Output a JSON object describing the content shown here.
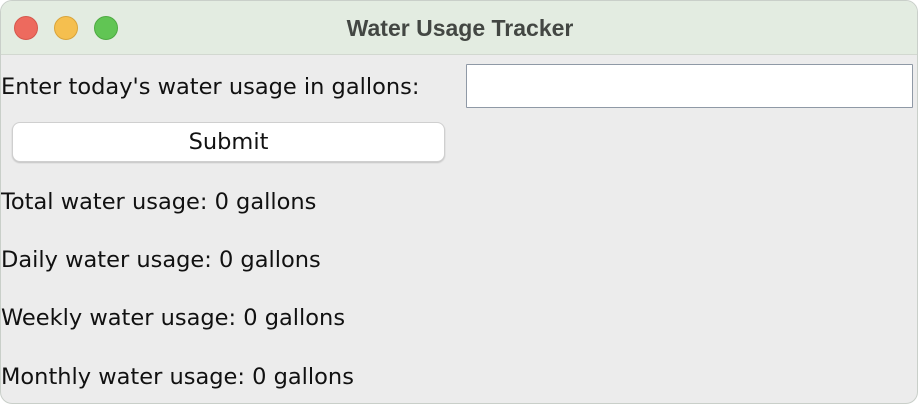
{
  "window": {
    "title": "Water Usage Tracker"
  },
  "form": {
    "prompt_label": "Enter today's water usage in gallons:",
    "input_value": "",
    "input_placeholder": "",
    "submit_label": "Submit"
  },
  "stats": {
    "total": "Total water usage: 0 gallons",
    "daily": "Daily water usage: 0 gallons",
    "weekly": "Weekly water usage: 0 gallons",
    "monthly": "Monthly water usage: 0 gallons"
  },
  "colors": {
    "close": "#ed6a5e",
    "minimize": "#f5bf4f",
    "maximize": "#61c554",
    "titlebar": "#e3ece1",
    "window_bg": "#ececec"
  }
}
